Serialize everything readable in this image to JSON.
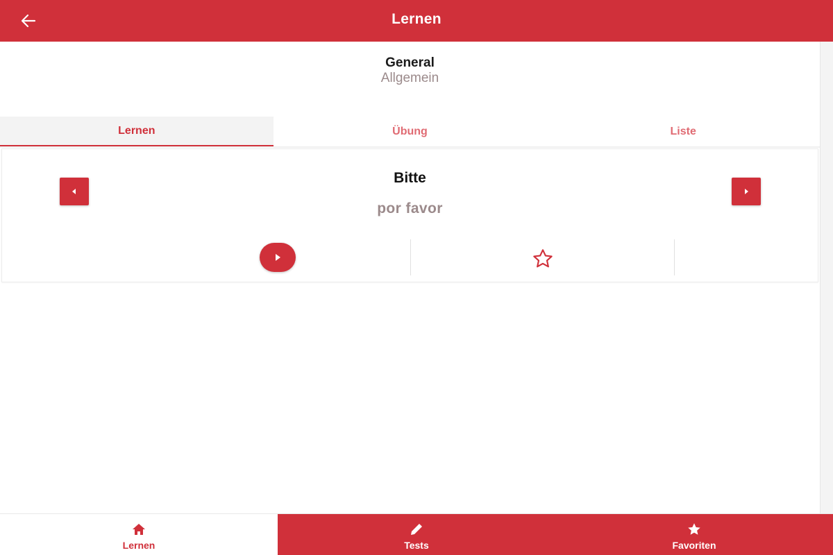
{
  "app_bar": {
    "title": "Lernen",
    "back_icon": "arrow-left-icon"
  },
  "category": {
    "title": "General",
    "subtitle": "Allgemein"
  },
  "tabs": [
    {
      "label": "Lernen",
      "active": true
    },
    {
      "label": "Übung",
      "active": false
    },
    {
      "label": "Liste",
      "active": false
    }
  ],
  "card": {
    "word": "Bitte",
    "translation": "por favor",
    "prev_icon": "caret-left-icon",
    "next_icon": "caret-right-icon",
    "play_icon": "play-icon",
    "favorite_icon": "star-outline-icon"
  },
  "bottom_nav": [
    {
      "label": "Lernen",
      "icon": "home-icon",
      "active": true
    },
    {
      "label": "Tests",
      "icon": "pencil-icon",
      "active": false
    },
    {
      "label": "Favoriten",
      "icon": "star-icon",
      "active": false
    }
  ],
  "colors": {
    "primary": "#d0303a",
    "muted_text": "#9b8a8b",
    "tab_inactive": "#e06b73"
  }
}
